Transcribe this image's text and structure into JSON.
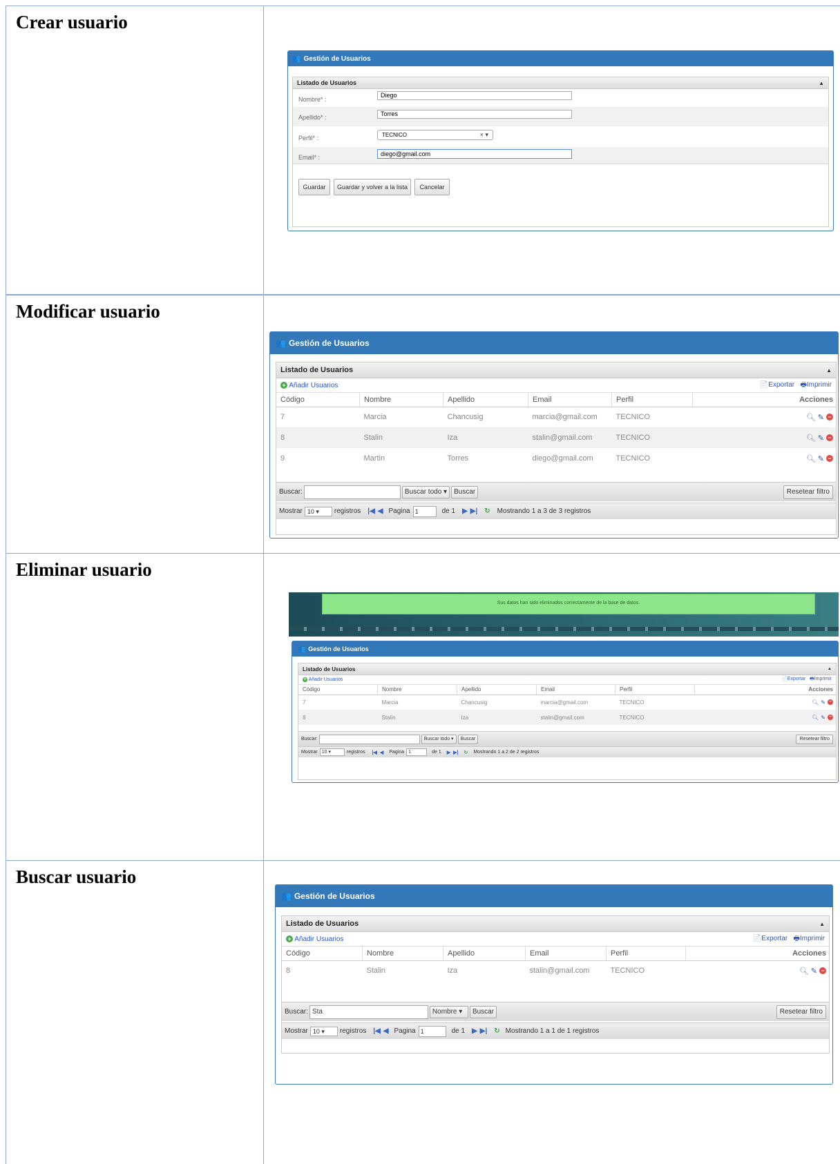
{
  "rows": {
    "crear": "Crear usuario",
    "modificar": "Modificar usuario",
    "eliminar": "Eliminar usuario",
    "buscar": "Buscar usuario"
  },
  "panel_title": "Gestión de Usuarios",
  "list_title": "Listado de Usuarios",
  "form": {
    "fields": [
      {
        "label": "Nombre* :",
        "value": "Diego"
      },
      {
        "label": "Apellido* :",
        "value": "Torres"
      },
      {
        "label": "Perfil* :",
        "value": "TECNICO"
      },
      {
        "label": "Email* :",
        "value": "diego@gmail.com"
      }
    ],
    "clear_mark": "×",
    "buttons": [
      "Guardar",
      "Guardar y volver a la lista",
      "Cancelar"
    ]
  },
  "toolbar": {
    "add": "Añadir Usuarios",
    "export": "Exportar",
    "print": "Imprimir"
  },
  "columns": [
    "Código",
    "Nombre",
    "Apellido",
    "Email",
    "Perfil",
    "Acciones"
  ],
  "modificar": {
    "rows": [
      [
        "7",
        "Marcia",
        "Chancusig",
        "marcia@gmail.com",
        "TECNICO"
      ],
      [
        "8",
        "Stalin",
        "Iza",
        "stalin@gmail.com",
        "TECNICO"
      ],
      [
        "9",
        "Martin",
        "Torres",
        "diego@gmail.com",
        "TECNICO"
      ]
    ],
    "search_value": "",
    "search_field": "Buscar todo",
    "summary": "Mostrando 1 a 3 de 3 registros"
  },
  "eliminar": {
    "notice": "Sus datos han sido eliminados correctamente de la base de datos.",
    "rows": [
      [
        "7",
        "Marcia",
        "Chancusig",
        "marcia@gmail.com",
        "TECNICO"
      ],
      [
        "8",
        "Stalin",
        "Iza",
        "stalin@gmail.com",
        "TECNICO"
      ]
    ],
    "search_value": "",
    "search_field": "Buscar todo",
    "summary": "Mostrando 1 a 2 de 2 registros"
  },
  "buscar": {
    "rows": [
      [
        "8",
        "Stalin",
        "Iza",
        "stalin@gmail.com",
        "TECNICO"
      ]
    ],
    "search_value": "Sta",
    "search_field": "Nombre",
    "summary": "Mostrando 1 a 1 de 1 registros"
  },
  "footer": {
    "search_label": "Buscar:",
    "search_button": "Buscar",
    "reset": "Resetear filtro",
    "show": "Mostrar",
    "page_size": "10",
    "records": "registros",
    "page_label": "Pagina",
    "page": "1",
    "of": "de 1"
  },
  "colors": {
    "panel_header": "#3378b8",
    "notice": "#8ee68a",
    "accent_link": "#2a56c6"
  }
}
